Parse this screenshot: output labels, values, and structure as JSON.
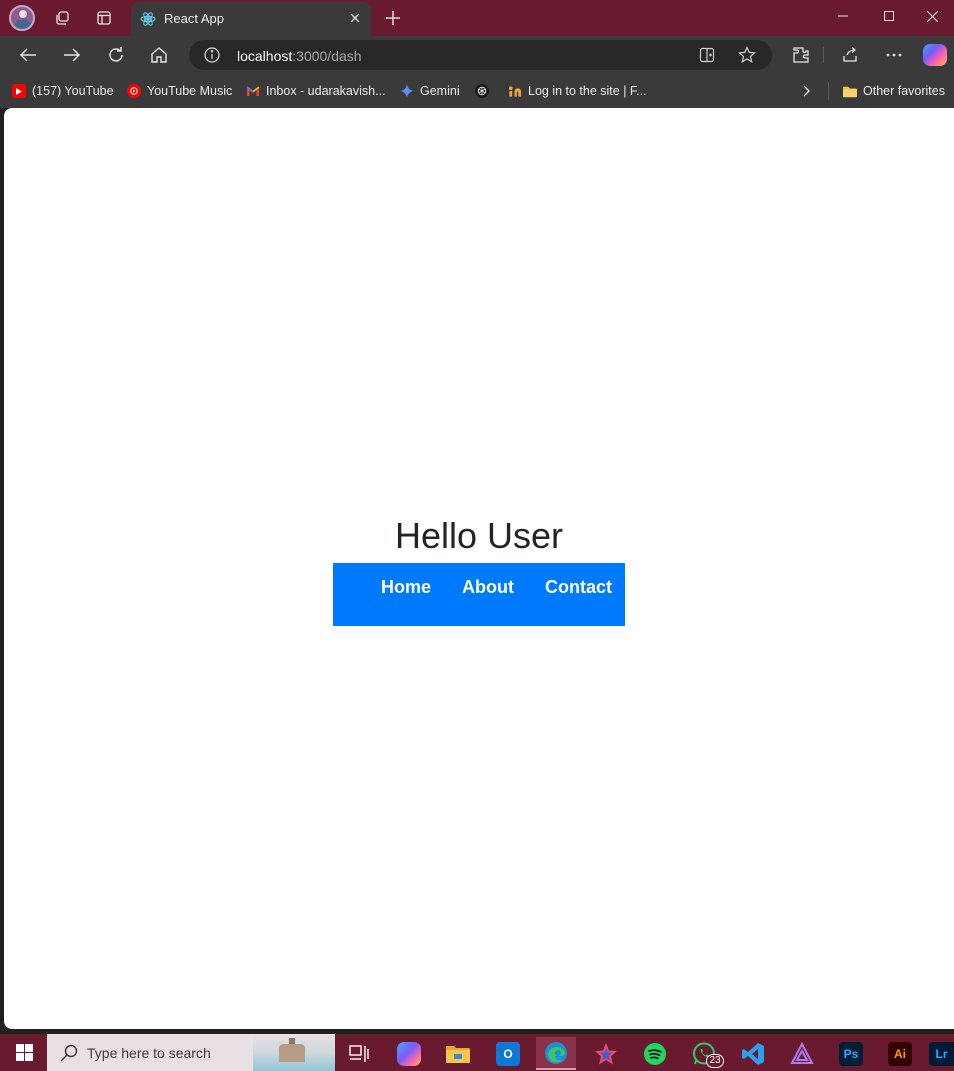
{
  "browser": {
    "tab": {
      "title": "React App"
    },
    "address_bar": {
      "host": "localhost",
      "path": ":3000/dash"
    },
    "favorites": [
      {
        "label": "(157) YouTube",
        "icon": "youtube-icon"
      },
      {
        "label": "YouTube Music",
        "icon": "youtube-music-icon"
      },
      {
        "label": "Inbox - udarakavish...",
        "icon": "gmail-icon"
      },
      {
        "label": "Gemini",
        "icon": "gemini-icon"
      },
      {
        "label": "",
        "icon": "chatgpt-icon"
      },
      {
        "label": "Log in to the site | F...",
        "icon": "fiverr-icon"
      }
    ],
    "other_favorites": "Other favorites"
  },
  "page": {
    "heading": "Hello User",
    "nav": [
      "Home",
      "About",
      "Contact"
    ]
  },
  "taskbar": {
    "search_placeholder": "Type here to search",
    "whatsapp_badge": "23",
    "apps": [
      "task-view",
      "copilot",
      "file-explorer",
      "outlook",
      "edge",
      "fluent-app",
      "spotify",
      "whatsapp",
      "vscode",
      "affinity",
      "photoshop",
      "illustrator",
      "lightroom"
    ]
  },
  "colors": {
    "titlebar": "#6a1a2f",
    "toolbar": "#3a3a3a",
    "nav_background": "#007bff",
    "heading_text": "#212529"
  }
}
